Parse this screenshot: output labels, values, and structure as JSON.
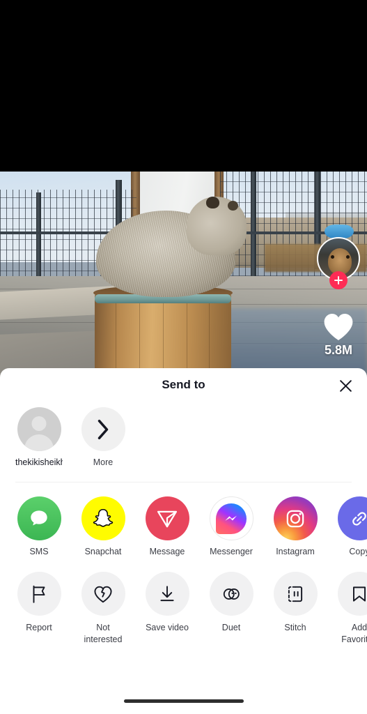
{
  "video": {
    "scene_description": "capybara sitting in a wooden barrel in an outdoor enclosure",
    "like_count": "5.8M",
    "follow_icon": "plus-icon",
    "like_icon": "heart-icon",
    "avatar_icon": "creator-avatar"
  },
  "sheet": {
    "title": "Send to",
    "close_icon": "close-icon",
    "recipients": [
      {
        "label": "thekikisheikh",
        "icon": "avatar-placeholder-icon"
      },
      {
        "label": "More",
        "icon": "chevron-right-icon"
      }
    ],
    "apps": [
      {
        "label": "SMS",
        "icon": "sms-icon",
        "color": "#4ec262"
      },
      {
        "label": "Snapchat",
        "icon": "snapchat-icon",
        "color": "#fffc00"
      },
      {
        "label": "Message",
        "icon": "message-icon",
        "color": "#e8455c"
      },
      {
        "label": "Messenger",
        "icon": "messenger-icon",
        "color": "#ffffff"
      },
      {
        "label": "Instagram",
        "icon": "instagram-icon",
        "color": "#e23a82"
      },
      {
        "label": "Copy",
        "icon": "copy-link-icon",
        "color": "#6a6ae8"
      }
    ],
    "actions": [
      {
        "label": "Report",
        "icon": "flag-icon"
      },
      {
        "label": "Not interested",
        "icon": "broken-heart-icon"
      },
      {
        "label": "Save video",
        "icon": "download-icon"
      },
      {
        "label": "Duet",
        "icon": "duet-icon"
      },
      {
        "label": "Stitch",
        "icon": "stitch-icon"
      },
      {
        "label": "Add Favorites",
        "icon": "bookmark-icon"
      }
    ]
  },
  "system": {
    "home_indicator": "home-indicator"
  }
}
